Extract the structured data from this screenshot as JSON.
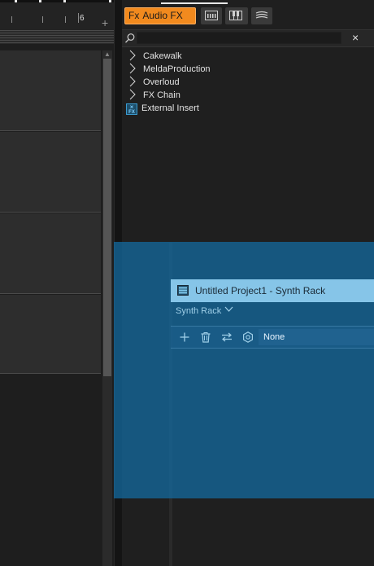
{
  "timeline": {
    "ruler_number": "6",
    "add_label": "+"
  },
  "browser": {
    "tabs": [
      {
        "label": "Audio FX",
        "icon": "fx-glyph",
        "active": true,
        "color": "#f28a1e"
      },
      {
        "label": "",
        "icon": "midi-icon"
      },
      {
        "label": "",
        "icon": "instruments-icon"
      },
      {
        "label": "",
        "icon": "loops-icon"
      }
    ],
    "fx_glyph": "Fx",
    "search": {
      "placeholder": "",
      "value": "",
      "clear_label": "×"
    },
    "tree": [
      {
        "label": "Cakewalk",
        "type": "folder"
      },
      {
        "label": "MeldaProduction",
        "type": "folder"
      },
      {
        "label": "Overloud",
        "type": "folder"
      },
      {
        "label": "FX Chain",
        "type": "folder"
      },
      {
        "label": "External Insert",
        "type": "plugin",
        "badge": "FX"
      }
    ]
  },
  "synth_rack": {
    "title": "Untitled Project1 - Synth Rack",
    "menu_label": "Synth Rack",
    "toolbar_icons": [
      "add-icon",
      "trash-icon",
      "swap-icon",
      "settings-icon"
    ],
    "selected_instrument": "None",
    "overlay_color": "#146ea5"
  }
}
